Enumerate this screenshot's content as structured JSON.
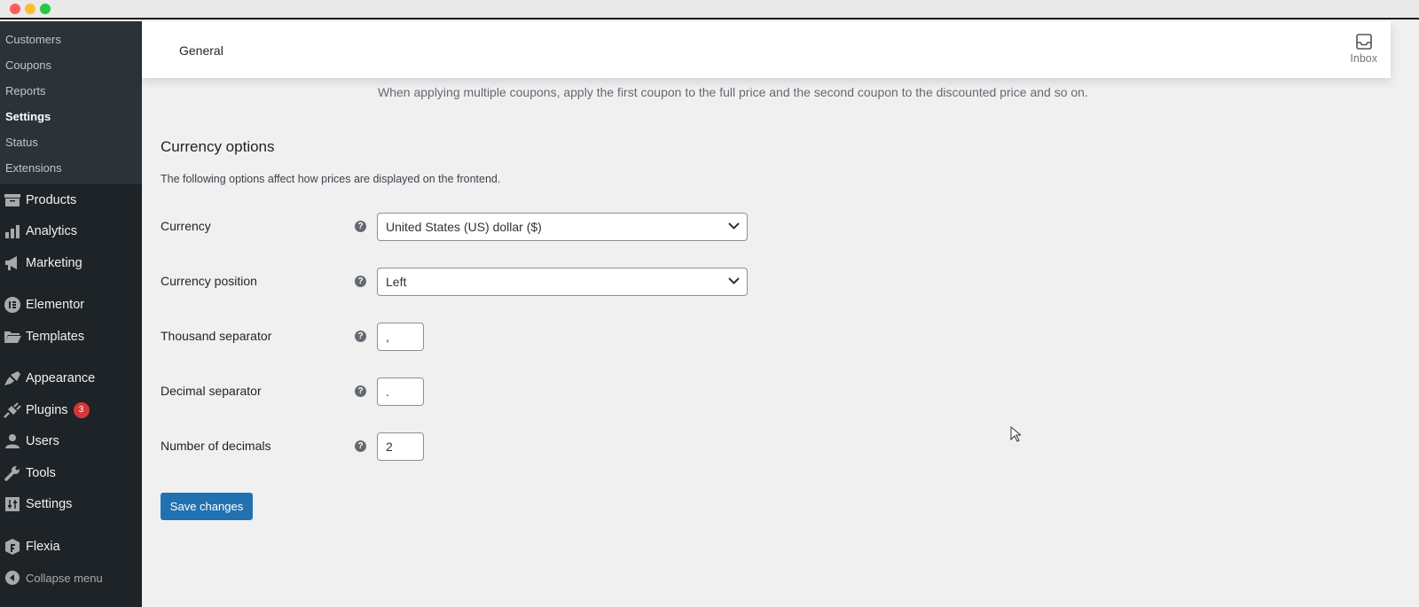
{
  "window": {
    "controls": [
      "close",
      "minimize",
      "maximize"
    ]
  },
  "sidebar": {
    "submenu": [
      {
        "label": "Customers"
      },
      {
        "label": "Coupons"
      },
      {
        "label": "Reports"
      },
      {
        "label": "Settings",
        "active": true
      },
      {
        "label": "Status"
      },
      {
        "label": "Extensions"
      }
    ],
    "menu": [
      {
        "label": "Products",
        "icon": "archive-icon"
      },
      {
        "label": "Analytics",
        "icon": "bar-chart-icon"
      },
      {
        "label": "Marketing",
        "icon": "megaphone-icon"
      },
      {
        "label": "Elementor",
        "icon": "elementor-icon"
      },
      {
        "label": "Templates",
        "icon": "folder-icon"
      },
      {
        "label": "Appearance",
        "icon": "paintbrush-icon"
      },
      {
        "label": "Plugins",
        "icon": "plug-icon",
        "badge": "3"
      },
      {
        "label": "Users",
        "icon": "user-icon"
      },
      {
        "label": "Tools",
        "icon": "wrench-icon"
      },
      {
        "label": "Settings",
        "icon": "sliders-icon"
      },
      {
        "label": "Flexia",
        "icon": "flexia-icon"
      }
    ],
    "collapse_label": "Collapse menu"
  },
  "header": {
    "title": "General",
    "inbox_label": "Inbox"
  },
  "main": {
    "coupon_note": "When applying multiple coupons, apply the first coupon to the full price and the second coupon to the discounted price and so on.",
    "section_title": "Currency options",
    "section_desc": "The following options affect how prices are displayed on the frontend.",
    "fields": [
      {
        "label": "Currency",
        "value": "United States (US) dollar ($)",
        "type": "select"
      },
      {
        "label": "Currency position",
        "value": "Left",
        "type": "select"
      },
      {
        "label": "Thousand separator",
        "value": ",",
        "type": "text"
      },
      {
        "label": "Decimal separator",
        "value": ".",
        "type": "text"
      },
      {
        "label": "Number of decimals",
        "value": "2",
        "type": "number"
      }
    ],
    "save_label": "Save changes"
  },
  "colors": {
    "accent": "#2271b1",
    "sidebar": "#1d2327",
    "submenu": "#2c3338",
    "badge": "#d63638"
  }
}
